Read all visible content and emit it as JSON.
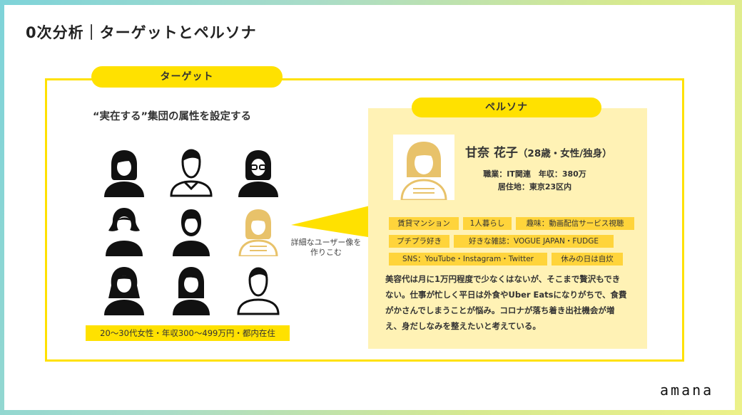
{
  "slide": {
    "title": "0次分析｜ターゲットとペルソナ",
    "logo_text": "amana"
  },
  "target": {
    "label": "ターゲット",
    "subheading": "“実在する”集団の属性を設定する",
    "attribute_band": "20〜30代女性・年収300〜499万円・都内在住",
    "callout": [
      "詳細なユーザー像を",
      "作りこむ"
    ]
  },
  "persona": {
    "label": "ペルソナ",
    "name": "甘奈 花子",
    "age_info": "（28歳・女性/独身）",
    "job_line": "職業：IT関連　年収：380万",
    "home_line": "居住地：東京23区内",
    "tags": [
      "賃貸マンション",
      "1人暮らし",
      "趣味：動画配信サービス視聴",
      "プチプラ好き",
      "好きな雑誌：VOGUE JAPAN・FUDGE",
      "SNS：YouTube・Instagram・Twitter",
      "休みの日は自炊"
    ],
    "description": [
      "美容代は月に1万円程度で少なくはないが、そこまで贅沢もでき",
      "ない。仕事が忙しく平日は外食やUber Eatsになりがちで、食費",
      "がかさんでしまうことが悩み。コロナが落ち着き出社機会が増",
      "え、身だしなみを整えたいと考えている。"
    ]
  },
  "colors": {
    "accent_yellow": "#ffe100",
    "persona_bg": "#fff2b5",
    "tag_yellow": "#ffd43b",
    "highlight_avatar": "#e8c26a"
  }
}
